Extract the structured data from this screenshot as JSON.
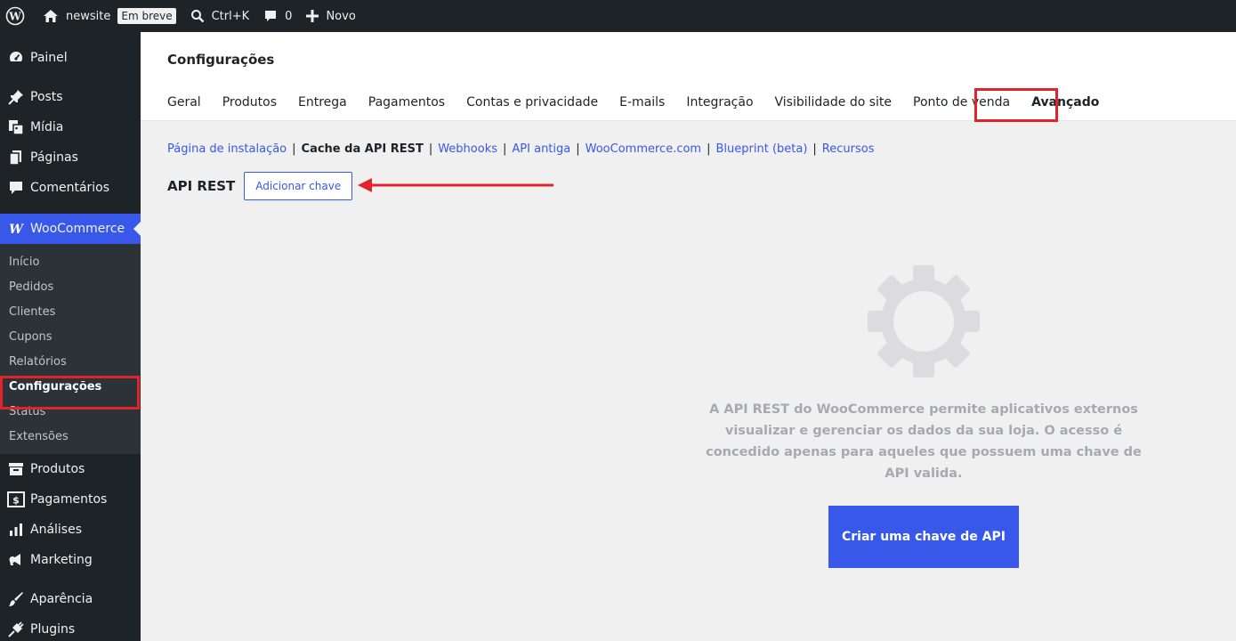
{
  "adminbar": {
    "site_name": "newsite",
    "soon_badge": "Em breve",
    "search_shortcut": "Ctrl+K",
    "comments_count": "0",
    "new_label": "Novo"
  },
  "sidebar": {
    "items_top": [
      {
        "label": "Painel",
        "icon": "dashboard-icon"
      },
      {
        "label": "Posts",
        "icon": "pin-icon"
      },
      {
        "label": "Mídia",
        "icon": "media-icon"
      },
      {
        "label": "Páginas",
        "icon": "pages-icon"
      },
      {
        "label": "Comentários",
        "icon": "comment-icon"
      }
    ],
    "woocommerce": {
      "label": "WooCommerce",
      "icon": "woo-icon"
    },
    "submenu": [
      "Início",
      "Pedidos",
      "Clientes",
      "Cupons",
      "Relatórios",
      "Configurações",
      "Status",
      "Extensões"
    ],
    "current_submenu": "Configurações",
    "items_bottom": [
      {
        "label": "Produtos",
        "icon": "archive-icon"
      },
      {
        "label": "Pagamentos",
        "icon": "money-icon"
      },
      {
        "label": "Análises",
        "icon": "chart-icon"
      },
      {
        "label": "Marketing",
        "icon": "megaphone-icon"
      },
      {
        "label": "Aparência",
        "icon": "brush-icon"
      },
      {
        "label": "Plugins",
        "icon": "plug-icon"
      }
    ]
  },
  "page": {
    "title": "Configurações",
    "tabs": [
      "Geral",
      "Produtos",
      "Entrega",
      "Pagamentos",
      "Contas e privacidade",
      "E-mails",
      "Integração",
      "Visibilidade do site",
      "Ponto de venda",
      "Avançado"
    ],
    "current_tab": "Avançado",
    "subsections": [
      "Página de instalação",
      "Cache da API REST",
      "Webhooks",
      "API antiga",
      "WooCommerce.com",
      "Blueprint (beta)",
      "Recursos"
    ],
    "current_subsection": "Cache da API REST",
    "section_title": "API REST",
    "add_key_label": "Adicionar chave",
    "empty_text": "A API REST do WooCommerce permite aplicativos externos visualizar e gerenciar os dados da sua loja. O acesso é concedido apenas para aqueles que possuem uma chave de API valida.",
    "create_key_label": "Criar uma chave de API"
  },
  "colors": {
    "accent": "#3858e9",
    "adminbar_bg": "#1d2327",
    "highlight": "#e0242a"
  }
}
